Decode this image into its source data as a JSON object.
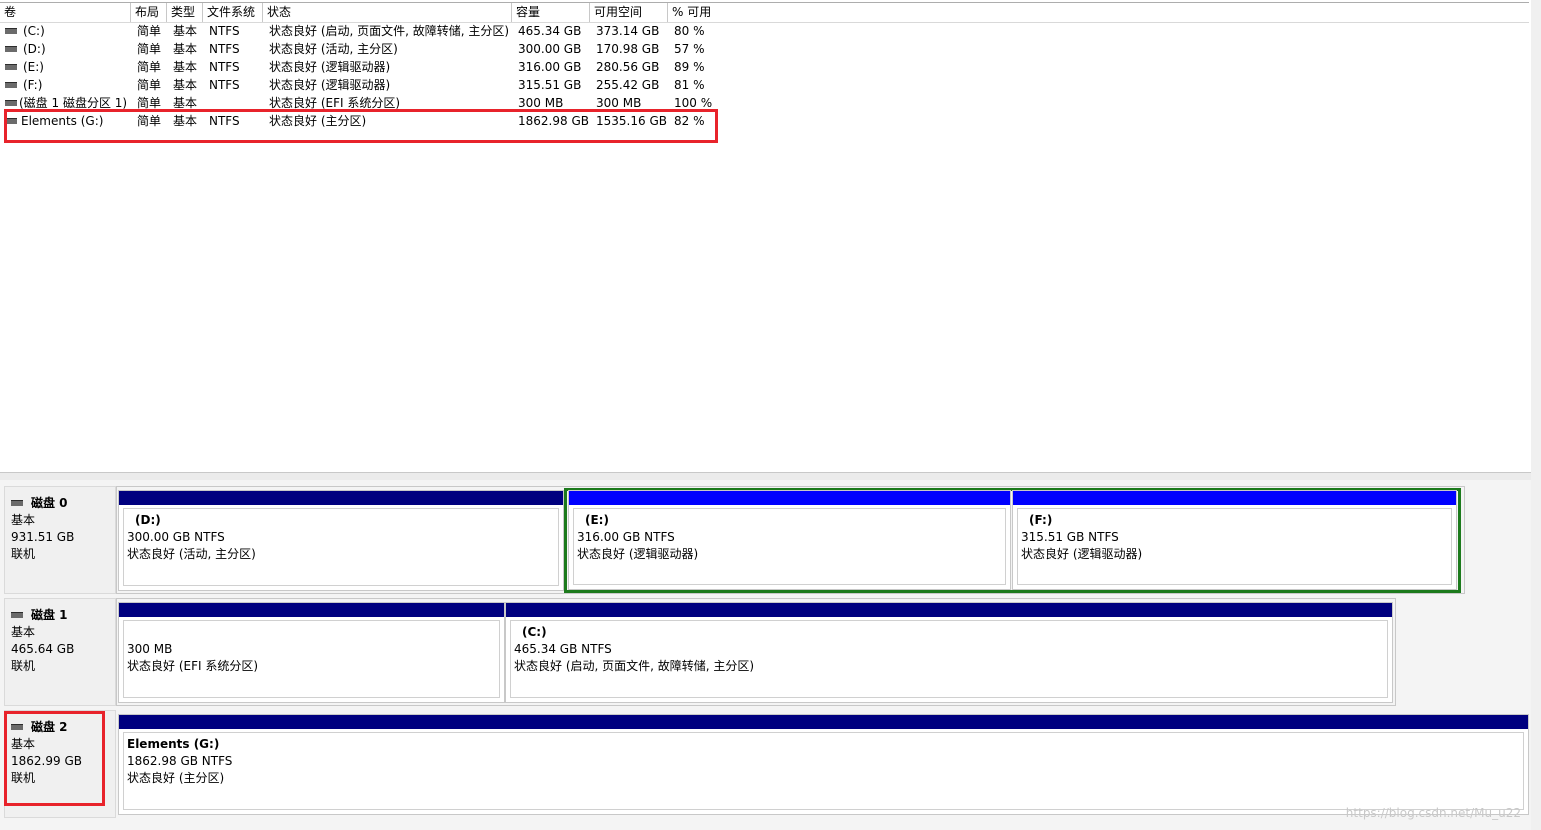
{
  "columns": [
    {
      "key": "volume",
      "label": "卷"
    },
    {
      "key": "layout",
      "label": "布局"
    },
    {
      "key": "type",
      "label": "类型"
    },
    {
      "key": "fs",
      "label": "文件系统"
    },
    {
      "key": "status",
      "label": "状态"
    },
    {
      "key": "capacity",
      "label": "容量"
    },
    {
      "key": "free",
      "label": "可用空间"
    },
    {
      "key": "pct",
      "label": "% 可用"
    }
  ],
  "volumes": [
    {
      "volume": "(C:)",
      "layout": "简单",
      "type": "基本",
      "fs": "NTFS",
      "status": "状态良好 (启动, 页面文件, 故障转储, 主分区)",
      "capacity": "465.34 GB",
      "free": "373.14 GB",
      "pct": "80 %"
    },
    {
      "volume": "(D:)",
      "layout": "简单",
      "type": "基本",
      "fs": "NTFS",
      "status": "状态良好 (活动, 主分区)",
      "capacity": "300.00 GB",
      "free": "170.98 GB",
      "pct": "57 %"
    },
    {
      "volume": "(E:)",
      "layout": "简单",
      "type": "基本",
      "fs": "NTFS",
      "status": "状态良好 (逻辑驱动器)",
      "capacity": "316.00 GB",
      "free": "280.56 GB",
      "pct": "89 %"
    },
    {
      "volume": "(F:)",
      "layout": "简单",
      "type": "基本",
      "fs": "NTFS",
      "status": "状态良好 (逻辑驱动器)",
      "capacity": "315.51 GB",
      "free": "255.42 GB",
      "pct": "81 %"
    },
    {
      "volume": "(磁盘 1 磁盘分区 1)",
      "layout": "简单",
      "type": "基本",
      "fs": "",
      "status": "状态良好 (EFI 系统分区)",
      "capacity": "300 MB",
      "free": "300 MB",
      "pct": "100 %"
    },
    {
      "volume": "Elements (G:)",
      "layout": "简单",
      "type": "基本",
      "fs": "NTFS",
      "status": "状态良好 (主分区)",
      "capacity": "1862.98 GB",
      "free": "1535.16 GB",
      "pct": "82 %"
    }
  ],
  "disks": [
    {
      "name": "磁盘 0",
      "type": "基本",
      "size": "931.51 GB",
      "state": "联机",
      "partitions": [
        {
          "name": "(D:)",
          "size": "300.00 GB NTFS",
          "status": "状态良好 (活动, 主分区)"
        },
        {
          "name": "(E:)",
          "size": "316.00 GB NTFS",
          "status": "状态良好 (逻辑驱动器)"
        },
        {
          "name": "(F:)",
          "size": "315.51 GB NTFS",
          "status": "状态良好 (逻辑驱动器)"
        }
      ]
    },
    {
      "name": "磁盘 1",
      "type": "基本",
      "size": "465.64 GB",
      "state": "联机",
      "partitions": [
        {
          "name": "",
          "size": "300 MB",
          "status": "状态良好 (EFI 系统分区)"
        },
        {
          "name": "(C:)",
          "size": "465.34 GB NTFS",
          "status": "状态良好 (启动, 页面文件, 故障转储, 主分区)"
        }
      ]
    },
    {
      "name": "磁盘 2",
      "type": "基本",
      "size": "1862.99 GB",
      "state": "联机",
      "partitions": [
        {
          "name": "Elements  (G:)",
          "size": "1862.98 GB NTFS",
          "status": "状态良好 (主分区)"
        }
      ]
    }
  ],
  "colors": {
    "primary_bar": "#00007f",
    "logical_bar": "#0000ff",
    "highlight": "#e8232b",
    "extended_frame": "#1c7a1c"
  },
  "watermark": "https://blog.csdn.net/Mu_u22"
}
